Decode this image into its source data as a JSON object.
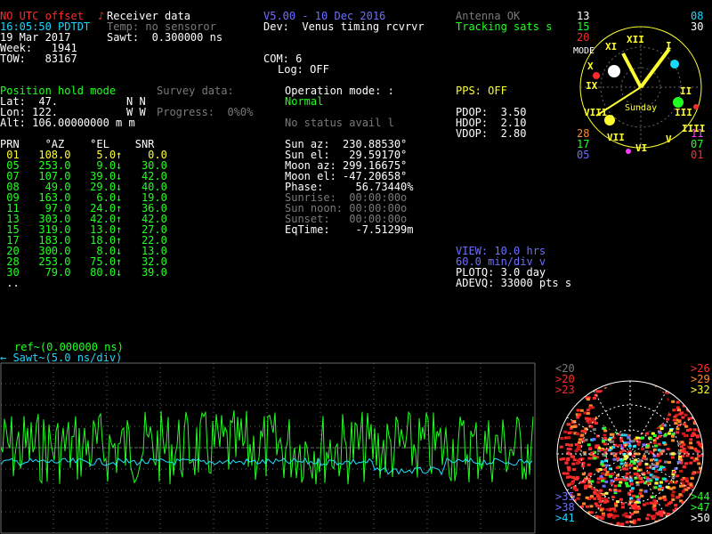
{
  "header": {
    "utc_status": "NO UTC offset",
    "receiver_title": "Receiver data",
    "time": "16:05:50 PDTDT",
    "temp": "Temp: no sensoror",
    "date": "19 Mar 2017",
    "sawt": "Sawt:  0.300000 ns",
    "week": "Week:   1941",
    "tow": "TOW:   83167",
    "version": "V5.00 - 10 Dec 2016",
    "device": "Dev:  Venus timing rcvrvr",
    "antenna": "Antenna OK",
    "tracking": "Tracking sats s",
    "com": "COM: 6",
    "log": "Log: OFF"
  },
  "position": {
    "mode": "Position hold mode",
    "lat": "Lat:  47.",
    "lat_hemi": "N N",
    "lon": "Lon: 122.",
    "lon_hemi": "W W",
    "alt": "Alt: 106.00000000 m m",
    "survey": "Survey data:",
    "progress": "Progress:  0%0%"
  },
  "operation": {
    "mode_label": "Operation mode: :",
    "mode_value": "Normal",
    "status": "No status avail l",
    "pps": "PPS: OFF",
    "pdop": "PDOP:  3.50",
    "hdop": "HDOP:  2.10",
    "vdop": "VDOP:  2.80"
  },
  "satellites": {
    "header": "PRN    °AZ    °EL    SNR",
    "rows": [
      {
        "text": " 01   108.0    5.0↑    0.0",
        "color": "yellow"
      },
      {
        "text": " 05   253.0    9.0↓   30.0",
        "color": "green"
      },
      {
        "text": " 07   107.0   39.0↓   42.0",
        "color": "green"
      },
      {
        "text": " 08    49.0   29.0↓   40.0",
        "color": "green"
      },
      {
        "text": " 09   163.0    6.0↓   19.0",
        "color": "green"
      },
      {
        "text": " 11    97.0   24.0↑   36.0",
        "color": "green"
      },
      {
        "text": " 13   303.0   42.0↑   42.0",
        "color": "green"
      },
      {
        "text": " 15   319.0   13.0↑   27.0",
        "color": "green"
      },
      {
        "text": " 17   183.0   18.0↑   22.0",
        "color": "green"
      },
      {
        "text": " 20   300.0    8.0↓   13.0",
        "color": "green"
      },
      {
        "text": " 28   253.0   75.0↑   32.0",
        "color": "green"
      },
      {
        "text": " 30    79.0   80.0↓   39.0",
        "color": "green"
      },
      {
        "text": " ..",
        "color": "white"
      }
    ]
  },
  "astro": {
    "sun_az": "Sun az:  230.88530°",
    "sun_el": "Sun el:   29.59170°",
    "moon_az": "Moon az: 299.16675°",
    "moon_el": "Moon el: -47.20658°",
    "phase": "Phase:     56.73440%",
    "sunrise": "Sunrise:  00:00:00o",
    "sun_noon": "Sun noon: 00:00:00o",
    "sunset": "Sunset:   00:00:00o",
    "eqtime": "EqTime:    -7.51299m"
  },
  "plot_settings": {
    "view": "VIEW: 10.0 hrs",
    "min_div": "60.0 min/div v",
    "plotq": "PLOTQ: 3.0 day",
    "adevq": "ADEVQ: 33000 pts s"
  },
  "graph": {
    "ref_label": "ref~(0.000000 ns)",
    "sawt_label": "← Sawt~(5.0 ns/div)",
    "colors": {
      "sawtooth": "#20ff20",
      "ref": "#20e0ff",
      "grid": "#6a6a6a"
    }
  },
  "clock": {
    "weekday": "Sunday",
    "numerals": [
      "XII",
      "I",
      "II",
      "III",
      "IIII",
      "V",
      "VI",
      "VII",
      "VIII",
      "IX",
      "X",
      "XI"
    ],
    "mode_label": "MODE"
  },
  "sky_labels_left": [
    {
      "text": "13",
      "color": "#ffffff"
    },
    {
      "text": "15",
      "color": "#22ff22"
    },
    {
      "text": "20",
      "color": "#ff2a2a"
    }
  ],
  "sky_labels_right": [
    {
      "text": "08",
      "color": "#18d8ff"
    },
    {
      "text": "30",
      "color": "#ffffff"
    }
  ],
  "sky_labels_bottom_left": [
    {
      "text": "28",
      "color": "#ff8a2a"
    },
    {
      "text": "17",
      "color": "#22ff22"
    },
    {
      "text": "05",
      "color": "#6e6eff"
    }
  ],
  "sky_labels_bottom_right": [
    {
      "text": "11",
      "color": "#ff3aff"
    },
    {
      "text": "07",
      "color": "#22ff22"
    },
    {
      "text": "01",
      "color": "#ff2a2a"
    }
  ],
  "snr_legend_top_left": [
    {
      "text": "<20",
      "color": "#7a7a7a"
    },
    {
      "text": ">20",
      "color": "#ff2a2a"
    },
    {
      "text": ">23",
      "color": "#ff2a2a"
    }
  ],
  "snr_legend_top_right": [
    {
      "text": ">26",
      "color": "#ff2a2a"
    },
    {
      "text": ">29",
      "color": "#ff8a2a"
    },
    {
      "text": ">32",
      "color": "#ffff30"
    }
  ],
  "snr_legend_bottom_left": [
    {
      "text": ">35",
      "color": "#6e6eff"
    },
    {
      "text": ">38",
      "color": "#6e6eff"
    },
    {
      "text": ">41",
      "color": "#18d8ff"
    }
  ],
  "snr_legend_bottom_right": [
    {
      "text": ">44",
      "color": "#22ff22"
    },
    {
      "text": ">47",
      "color": "#22ff22"
    },
    {
      "text": ">50",
      "color": "#ffffff"
    }
  ]
}
